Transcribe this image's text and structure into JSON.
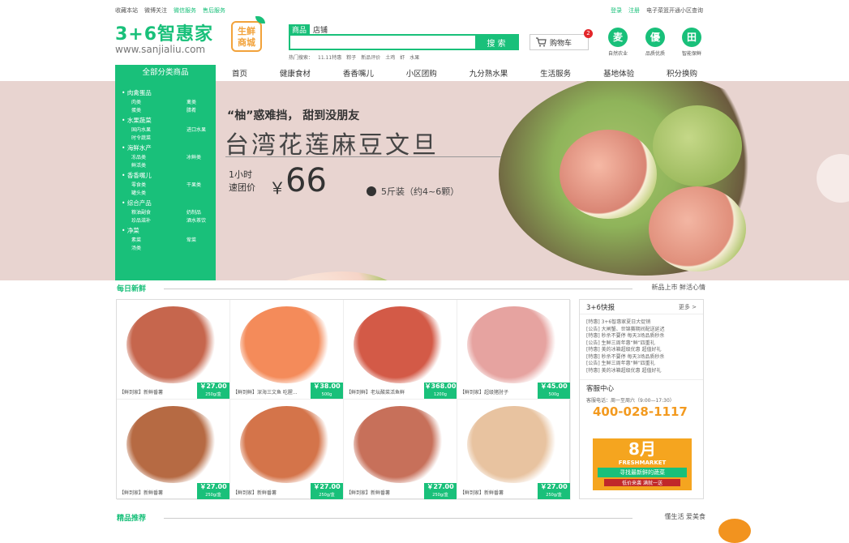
{
  "topbar": {
    "left": [
      "收藏本站",
      "微博关注",
      "微信服务",
      "售后服务"
    ],
    "right": [
      "登录",
      "注册",
      "电子菜篮开通小区查询"
    ]
  },
  "logo": {
    "mark": "3+6智惠家",
    "url": "www.sanjialiu.com",
    "fresh_line1": "生鲜",
    "fresh_line2": "商城"
  },
  "search": {
    "tab_goods": "商品",
    "tab_shop": "店铺",
    "placeholder": "",
    "button": "搜 索",
    "hot_label": "热门搜索：",
    "hot": [
      "11.11特惠",
      "粽子",
      "新品评价",
      "土鸡",
      "虾",
      "水果"
    ]
  },
  "cart": {
    "label": "购物车",
    "count": "2"
  },
  "features": [
    {
      "glyph": "麦",
      "label": "自然农业"
    },
    {
      "glyph": "優",
      "label": "品质优质"
    },
    {
      "glyph": "田",
      "label": "智能保鲜"
    }
  ],
  "nav": {
    "all": "全部分类商品",
    "items": [
      "首页",
      "健康食材",
      "香香嘴儿",
      "小区团购",
      "九分熟水果",
      "生活服务",
      "基地体验",
      "积分换购"
    ]
  },
  "menu": [
    {
      "cat": "肉禽蛋品",
      "subs": [
        "肉类",
        "禽类",
        "蛋类",
        "腊肴"
      ]
    },
    {
      "cat": "水果蔬菜",
      "subs": [
        "国内水果",
        "进口水果",
        "时令蔬菜"
      ]
    },
    {
      "cat": "海鲜水产",
      "subs": [
        "冻品类",
        "冰鲜类",
        "鲜活类"
      ]
    },
    {
      "cat": "香香嘴儿",
      "subs": [
        "零食类",
        "干果类",
        "罐头类"
      ]
    },
    {
      "cat": "综合产品",
      "subs": [
        "粮油副食",
        "奶制品",
        "珍品滋补",
        "酒水茶饮"
      ]
    },
    {
      "cat": "净菜",
      "subs": [
        "素菜",
        "荤菜",
        "汤类"
      ]
    }
  ],
  "banner": {
    "headline": "“柚”惑难挡， 甜到没朋友",
    "title": "台湾花莲麻豆文旦",
    "price_label_1": "1小时",
    "price_label_2": "速团价",
    "currency": "￥",
    "price": "66",
    "spec": "5斤装（约4~6颗）",
    "slides": 5,
    "active_slide": 3
  },
  "section_daily": {
    "title": "每日新鲜",
    "right": "新品上市  鲜活心情"
  },
  "section_recommend": {
    "title": "精品推荐",
    "right": "懂生活  爱美食"
  },
  "products": [
    {
      "name": "【鲜到家】新鲜番薯",
      "price": "￥27.00",
      "unit": "250g/盒",
      "color": "#c6664d"
    },
    {
      "name": "【鲜到鲜】深海三文鱼 吃腥...",
      "price": "￥38.00",
      "unit": "500g",
      "color": "#f48b5a"
    },
    {
      "name": "【鲜到鲜】老坛酸菜活鱼鲜",
      "price": "￥368.00",
      "unit": "1200g",
      "color": "#d35a47"
    },
    {
      "name": "【鲜到家】超级猪肘子",
      "price": "￥45.00",
      "unit": "500g",
      "color": "#e6a3a0"
    },
    {
      "name": "【鲜到家】新鲜番薯",
      "price": "￥27.00",
      "unit": "250g/盒",
      "color": "#b66a43"
    },
    {
      "name": "【鲜到家】新鲜番薯",
      "price": "￥27.00",
      "unit": "250g/盒",
      "color": "#d4744a"
    },
    {
      "name": "【鲜到家】新鲜番薯",
      "price": "￥27.00",
      "unit": "250g/盒",
      "color": "#c7705a"
    },
    {
      "name": "【鲜到家】新鲜番薯",
      "price": "￥27.00",
      "unit": "250g/盒",
      "color": "#e8c3a0"
    }
  ],
  "news": {
    "title": "3+6快报",
    "more": "更多 >",
    "items": [
      "[特惠]  3+6智惠家夏日大促销",
      "[公告]  大闸蟹、世锦赛期间配送延迟",
      "[特惠]  秒杀不要停 每天3场品质秒杀",
      "[公告]  生鲜三周年惠“鲜”四重礼",
      "[特惠]  美的冰箱超级优惠 超值好礼",
      "[特惠]  秒杀不要停 每天3场品质秒杀",
      "[公告]  生鲜三周年惠“鲜”四重礼",
      "[特惠]  美的冰箱超级优惠 超值好礼"
    ],
    "service_title": "客服中心",
    "service_hours": "客服电话：周一至周六（9:00—17:30）",
    "phone": "400-028-1117",
    "ad_month": "8月",
    "ad_brand": "FRESHMARKET",
    "ad_slogan": "寻找最新鲜的蔬菜",
    "ad_sub": "低价来袭 满就一送"
  },
  "accent": "#19c07a"
}
